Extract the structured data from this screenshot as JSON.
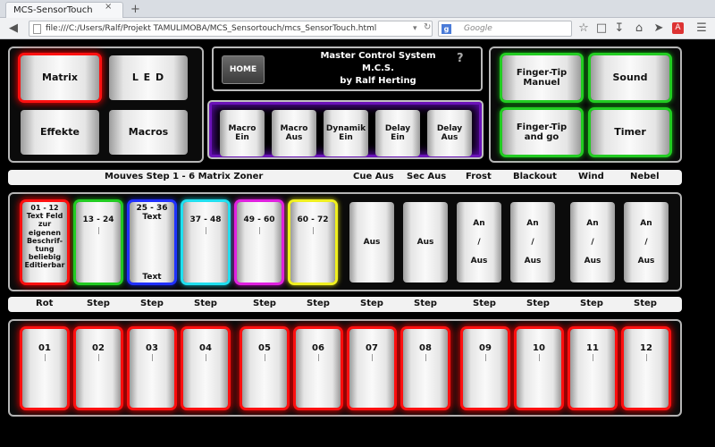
{
  "browser": {
    "tab_title": "MCS-SensorTouch",
    "tab_close": "×",
    "new_tab": "+",
    "url": "file:///C:/Users/Ralf/Projekt TAMULIMOBA/MCS_Sensortouch/mcs_SensorTouch.html",
    "search_placeholder": "Google",
    "search_engine_letter": "g"
  },
  "header": {
    "title_line1": "Master Control System",
    "title_line2": "M.C.S.",
    "title_line3": "by Ralf Herting",
    "home_label": "HOME",
    "help_label": "?"
  },
  "left_panel": {
    "matrix": "Matrix",
    "led": "L E D",
    "effekte": "Effekte",
    "macros": "Macros"
  },
  "macro_panel": {
    "macro_ein": "Macro\nEin",
    "macro_aus": "Macro\nAus",
    "dynamik_ein": "Dynamik\nEin",
    "delay_ein": "Delay\nEin",
    "delay_aus": "Delay\nAus"
  },
  "right_panel": {
    "finger_tip_manuel": "Finger-Tip\nManuel",
    "sound": "Sound",
    "finger_tip_go": "Finger-Tip\nand go",
    "timer": "Timer"
  },
  "labels_row1": {
    "mouves": "Mouves Step 1 - 6 Matrix Zoner",
    "cue_aus": "Cue Aus",
    "sec_aus": "Sec Aus",
    "frost": "Frost",
    "blackout": "Blackout",
    "wind": "Wind",
    "nebel": "Nebel"
  },
  "zone_buttons": {
    "z1": "01 - 12\nText Feld\nzur eigenen\nBeschrif-\ntung\nbeliebig\nEditierbar",
    "z2": "13 - 24",
    "z3_top": "25 - 36\nText",
    "z3_bottom": "Text",
    "z4": "37 - 48",
    "z5": "49 - 60",
    "z6": "60 - 72",
    "cue_aus": "Aus",
    "sec_aus": "Aus",
    "frost": "An\n\n/\n\nAus",
    "blackout": "An\n\n/\n\nAus",
    "wind": "An\n\n/\n\nAus",
    "nebel": "An\n\n/\n\nAus"
  },
  "labels_row2": {
    "rot": "Rot",
    "step": "Step"
  },
  "step_buttons": [
    "01",
    "02",
    "03",
    "04",
    "05",
    "06",
    "07",
    "08",
    "09",
    "10",
    "11",
    "12"
  ],
  "colors": {
    "red": "#ff1010",
    "green": "#22cc22",
    "blue": "#2030ff",
    "cyan": "#20e0f0",
    "magenta": "#e020e0",
    "yellow": "#f0f020",
    "purple": "#6a12b8"
  }
}
